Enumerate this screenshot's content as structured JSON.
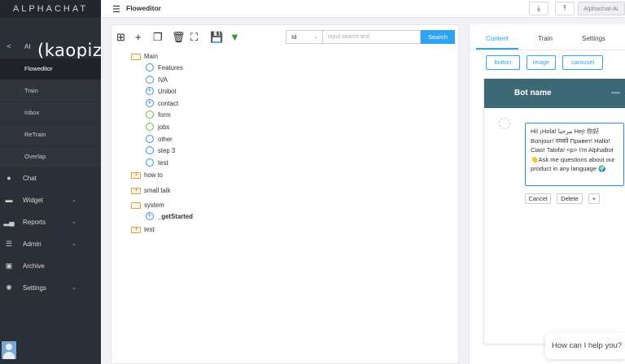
{
  "sidebar": {
    "brand": "ALPHACHAT",
    "ai_label": "AI",
    "logo_text": "kaopiz",
    "ai_subitems": [
      "Floweditor",
      "Train",
      "Inbox",
      "ReTrain",
      "Overlap"
    ],
    "items": [
      {
        "label": "Chat",
        "icon": "chat-icon",
        "chevron": false
      },
      {
        "label": "Widget",
        "icon": "widget-icon",
        "chevron": true
      },
      {
        "label": "Reports",
        "icon": "bar-chart-icon",
        "chevron": true
      },
      {
        "label": "Admin",
        "icon": "sliders-icon",
        "chevron": true
      },
      {
        "label": "Archive",
        "icon": "archive-icon",
        "chevron": false
      },
      {
        "label": "Settings",
        "icon": "gear-icon",
        "chevron": true
      }
    ],
    "active_subitem": "Floweditor"
  },
  "topbar": {
    "page_title": "Floweditor",
    "user_label": "Alphachat-Ai"
  },
  "editor": {
    "search": {
      "field_select": "Id",
      "placeholder": "input search text",
      "button_label": "Search"
    },
    "tree": {
      "main": "Main",
      "main_children": [
        "Features",
        "IVA",
        "Unibot",
        "contact",
        "form",
        "jobs",
        "other",
        "step 3",
        "test"
      ],
      "how_to": "how to",
      "small_talk": "small talk",
      "system": "system",
      "system_children": [
        "_getStarted"
      ],
      "test": "test"
    }
  },
  "right_panel": {
    "tabs": [
      "Content",
      "Train",
      "Settings"
    ],
    "active_tab": "Content",
    "chips": [
      "button",
      "image",
      "carousel"
    ],
    "chat": {
      "bot_name": "Bot name",
      "message": "Hi! ¡Hola! مرحبا Hej! 你好 Bonjour! नमस्ते Привет! Hallo! Ciao! Talofa! <p> I'm AlphaBot 👋Ask me questions about our product in any language 🌍",
      "actions": [
        "Cancel",
        "Delete",
        "+"
      ]
    },
    "help_text": "How can I help you?"
  }
}
